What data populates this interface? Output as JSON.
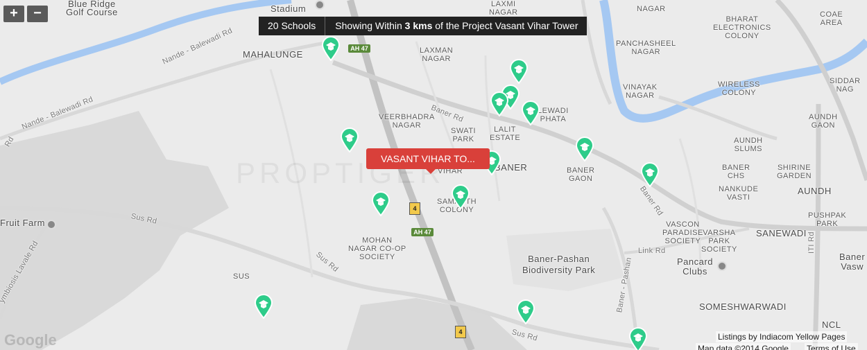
{
  "controls": {
    "zoom_in": "+",
    "zoom_out": "−"
  },
  "topbar": {
    "count_label": "20 Schools",
    "msg_prefix": "Showing Within ",
    "msg_distance": "3 kms",
    "msg_suffix": " of the Project Vasant Vihar Tower"
  },
  "tooltip": "VASANT VIHAR TO...",
  "watermark": "PROPTIGER",
  "labels": {
    "blue_ridge": "Blue Ridge\nGolf Course",
    "stadium": "Stadium",
    "laxmi_nagar": "LAXMI\nNAGAR",
    "nagar": "NAGAR",
    "coae_area": "COAE\nAREA",
    "bharat": "BHARAT\nELECTRONICS\nCOLONY",
    "mahalunge": "MAHALUNGE",
    "laxman_nagar": "LAXMAN\nNAGAR",
    "panchasheel": "PANCHASHEEL\nNAGAR",
    "vinayak": "VINAYAK\nNAGAR",
    "wireless": "WIRELESS\nCOLONY",
    "siddarth": "SIDDAR\nNAG",
    "nande_balewadi_top": "Nande - Balewadi Rd",
    "nande_balewadi_left": "Nande - Balewadi Rd",
    "baner_rd_top": "Baner Rd",
    "veerbhadra": "VEERBHADRA\nNAGAR",
    "swati_park": "SWATI\nPARK",
    "lalit_estate": "LALIT\nESTATE",
    "balewadi_phata": "LEWADI\nPHATA",
    "aundh_gaon": "AUNDH\nGAON",
    "aundh_slums": "AUNDH\nSLUMS",
    "vihar": "VIHAR",
    "baner": "BANER",
    "baner_gaon": "BANER\nGAON",
    "baner_chs": "BANER\nCHS",
    "shirine": "SHIRINE\nGARDEN",
    "aundh": "AUNDH",
    "nankude": "NANKUDE\nVASTI",
    "pushpak": "PUSHPAK\nPARK",
    "baner_rd_right": "Baner Rd",
    "samarth": "SAMARTH\nCOLONY",
    "fruit_farm": "Fruit Farm",
    "sus_rd_left": "Sus Rd",
    "vascon": "VASCON\nPARADISE\nSOCIETY",
    "varsha": "VARSHA\nPARK\nSOCIETY",
    "sanewadi": "SANEWADI",
    "iti_rd": "ITI Rd",
    "symbiosis": "ymbiosis Lavale Rd",
    "mohan_nagar": "MOHAN\nNAGAR CO-OP\nSOCIETY",
    "link_rd": "Link Rd",
    "baner_pashan_park": "Baner-Pashan\nBiodiversity Park",
    "pancard": "Pancard\nClubs",
    "baner_vasw": "Baner\nVasw",
    "sus_rd_mid": "Sus Rd",
    "sus": "SUS",
    "baner_pashan_rd": "Baner - Pashan",
    "someshwarwadi": "SOMESHWARWADI",
    "ncl": "NCL",
    "sus_rd_bottom": "Sus Rd",
    "rd_left": "Rd",
    "ah47_top": "AH 47",
    "ah47_mid": "AH 47",
    "nh4_mid": "4",
    "nh4_bottom": "4"
  },
  "attribution": {
    "google": "Google",
    "listings": "Listings by Indiacom Yellow Pages",
    "mapdata": "Map data ©2014 Google",
    "terms": "Terms of Use"
  },
  "colors": {
    "school_pin": "#2ecc8a",
    "tooltip": "#d9403a",
    "water": "#a5c8f2",
    "highway": "#b8b8b8"
  },
  "icons": {
    "pin": "school-pin-icon",
    "poi": "poi-circle-icon"
  }
}
